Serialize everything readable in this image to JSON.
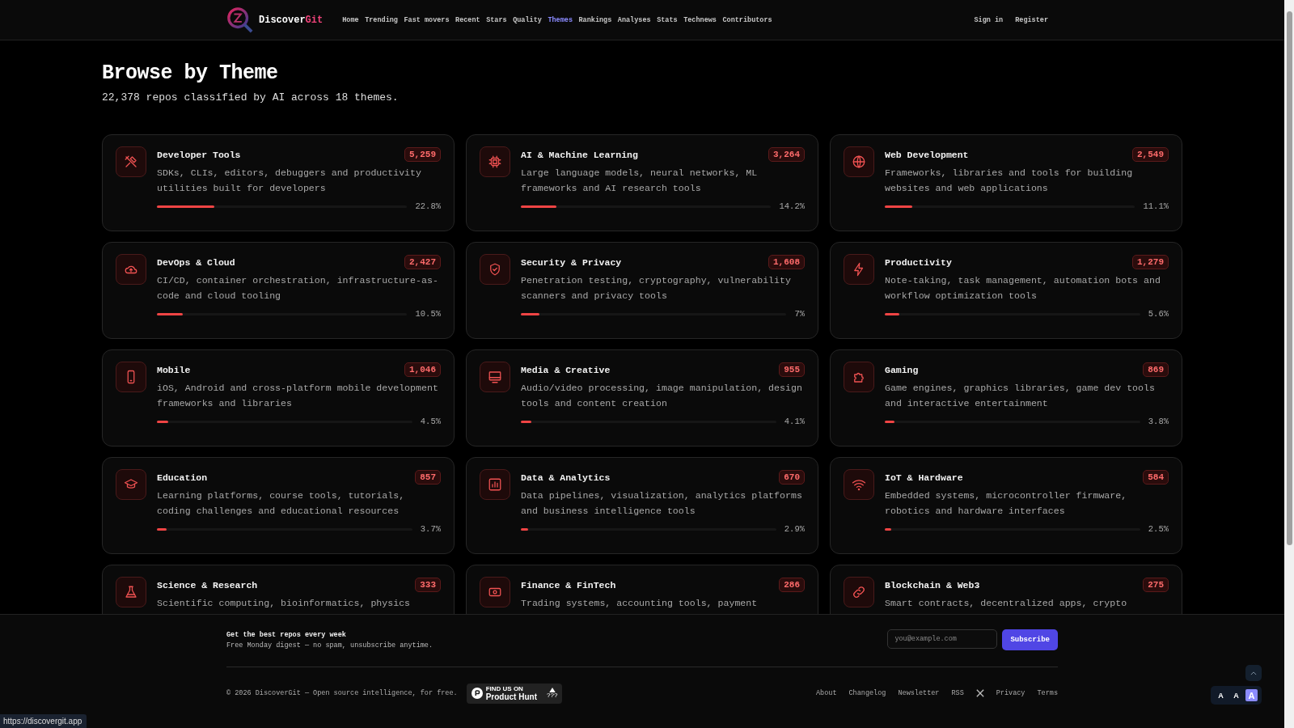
{
  "header": {
    "brand": {
      "first": "Discover",
      "second": "Git"
    },
    "nav": [
      {
        "label": "Home",
        "selected": false
      },
      {
        "label": "Trending",
        "selected": false
      },
      {
        "label": "Fast movers",
        "selected": false
      },
      {
        "label": "Recent",
        "selected": false
      },
      {
        "label": "Stars",
        "selected": false
      },
      {
        "label": "Quality",
        "selected": false
      },
      {
        "label": "Themes",
        "selected": true
      },
      {
        "label": "Rankings",
        "selected": false
      },
      {
        "label": "Analyses",
        "selected": false
      },
      {
        "label": "Stats",
        "selected": false
      },
      {
        "label": "Technews",
        "selected": false
      },
      {
        "label": "Contributors",
        "selected": false
      }
    ],
    "auth": [
      "Sign in",
      "Register"
    ]
  },
  "page": {
    "title": "Browse by Theme",
    "subtitle": "22,378 repos classified by AI across 18 themes."
  },
  "themes": [
    {
      "name": "Developer Tools",
      "count": "5,259",
      "description": "SDKs, CLIs, editors, debuggers and productivity utilities built for developers",
      "level": 0.228,
      "percent": "22.8%"
    },
    {
      "name": "AI & Machine Learning",
      "count": "3,264",
      "description": "Large language models, neural networks, ML frameworks and AI research tools",
      "level": 0.142,
      "percent": "14.2%"
    },
    {
      "name": "Web Development",
      "count": "2,549",
      "description": "Frameworks, libraries and tools for building websites and web applications",
      "level": 0.111,
      "percent": "11.1%"
    },
    {
      "name": "DevOps & Cloud",
      "count": "2,427",
      "description": "CI/CD, container orchestration, infrastructure-as-code and cloud tooling",
      "level": 0.105,
      "percent": "10.5%"
    },
    {
      "name": "Security & Privacy",
      "count": "1,608",
      "description": "Penetration testing, cryptography, vulnerability scanners and privacy tools",
      "level": 0.07,
      "percent": "7%"
    },
    {
      "name": "Productivity",
      "count": "1,279",
      "description": "Note-taking, task management, automation bots and workflow optimization tools",
      "level": 0.056,
      "percent": "5.6%"
    },
    {
      "name": "Mobile",
      "count": "1,046",
      "description": "iOS, Android and cross-platform mobile development frameworks and libraries",
      "level": 0.045,
      "percent": "4.5%"
    },
    {
      "name": "Media & Creative",
      "count": "955",
      "description": "Audio/video processing, image manipulation, design tools and content creation",
      "level": 0.041,
      "percent": "4.1%"
    },
    {
      "name": "Gaming",
      "count": "869",
      "description": "Game engines, graphics libraries, game dev tools and interactive entertainment",
      "level": 0.038,
      "percent": "3.8%"
    },
    {
      "name": "Education",
      "count": "857",
      "description": "Learning platforms, course tools, tutorials, coding challenges and educational resources",
      "level": 0.037,
      "percent": "3.7%"
    },
    {
      "name": "Data & Analytics",
      "count": "670",
      "description": "Data pipelines, visualization, analytics platforms and business intelligence tools",
      "level": 0.029,
      "percent": "2.9%"
    },
    {
      "name": "IoT & Hardware",
      "count": "584",
      "description": "Embedded systems, microcontroller firmware, robotics and hardware interfaces",
      "level": 0.025,
      "percent": "2.5%"
    },
    {
      "name": "Science & Research",
      "count": "333",
      "description": "Scientific computing, bioinformatics, physics"
    },
    {
      "name": "Finance & FinTech",
      "count": "286",
      "description": "Trading systems, accounting tools, payment"
    },
    {
      "name": "Blockchain & Web3",
      "count": "275",
      "description": "Smart contracts, decentralized apps, crypto"
    }
  ],
  "footer": {
    "newsletter": {
      "title": "Get the best repos every week",
      "text": "Free Monday digest — no spam, unsubscribe anytime.",
      "placeholder": "you@example.com",
      "button": "Subscribe"
    },
    "copyright": "© 2026 DiscoverGit — Open source intelligence, for free.",
    "badge": {
      "small": "FIND US ON",
      "name": "Product Hunt",
      "votes": "???"
    },
    "links": [
      {
        "label": "About",
        "kind": "text"
      },
      {
        "label": "Changelog",
        "kind": "text"
      },
      {
        "label": "Newsletter",
        "kind": "text"
      },
      {
        "label": "RSS",
        "kind": "text"
      },
      {
        "kind": "x"
      },
      {
        "label": "Privacy",
        "kind": "text"
      },
      {
        "label": "Terms",
        "kind": "text"
      }
    ]
  },
  "font_sizes": [
    {
      "label": "A",
      "selected": false
    },
    {
      "label": "A",
      "selected": false
    },
    {
      "label": "A",
      "selected": true
    }
  ],
  "status_url": "https://discovergit.app"
}
